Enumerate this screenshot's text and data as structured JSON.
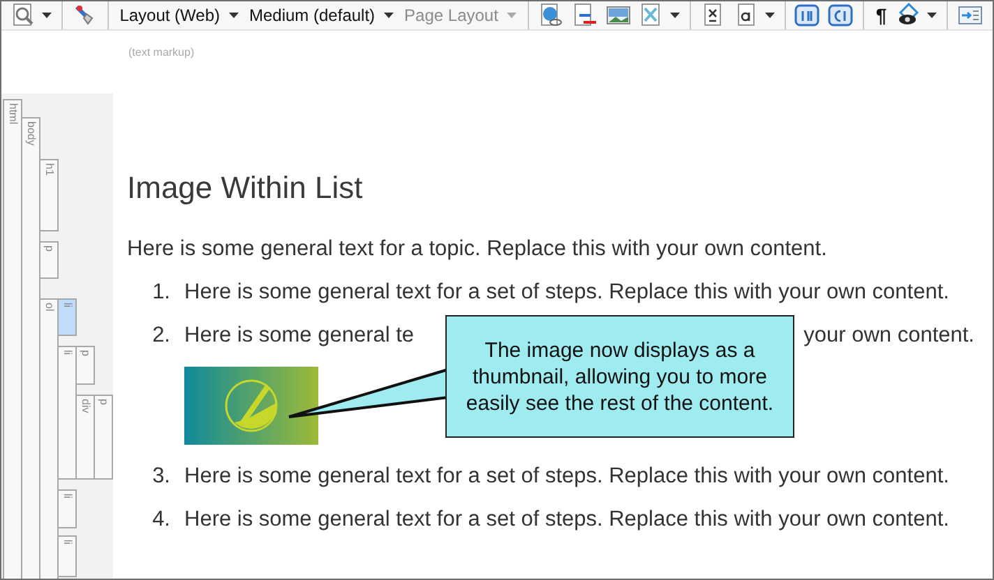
{
  "toolbar": [
    {
      "kind": "menu-button"
    },
    {
      "kind": "button"
    },
    {
      "kind": "dropdown",
      "label": "Layout (Web)",
      "disabled": false
    },
    {
      "kind": "dropdown",
      "label": "Medium (default)",
      "disabled": false
    },
    {
      "kind": "dropdown",
      "label": "Page Layout",
      "disabled": true
    },
    {
      "kind": "button"
    },
    {
      "kind": "button"
    },
    {
      "kind": "button"
    },
    {
      "kind": "menu-button"
    },
    {
      "kind": "button"
    },
    {
      "kind": "menu-button"
    },
    {
      "kind": "button"
    },
    {
      "kind": "button"
    },
    {
      "kind": "text",
      "label": "¶"
    },
    {
      "kind": "menu-button"
    },
    {
      "kind": "button"
    }
  ],
  "markup_hint": "(text markup)",
  "structure_bar": [
    {
      "label": "html",
      "selected": false,
      "children": [
        {
          "label": "body",
          "selected": false,
          "children": [
            {
              "label": "h1",
              "selected": false
            },
            {
              "label": "p",
              "selected": false
            },
            {
              "label": "ol",
              "selected": false,
              "children": [
                {
                  "label": "li",
                  "selected": true
                },
                {
                  "label": "li",
                  "selected": false,
                  "children": [
                    {
                      "label": "p",
                      "selected": false
                    },
                    {
                      "label": "div",
                      "selected": false,
                      "children": [
                        {
                          "label": "p",
                          "selected": false
                        }
                      ]
                    }
                  ]
                },
                {
                  "label": "li",
                  "selected": false
                },
                {
                  "label": "li",
                  "selected": false
                }
              ]
            }
          ]
        }
      ]
    }
  ],
  "document": {
    "heading": "Image Within List",
    "paragraph": "Here is some general text for a topic. Replace this with your own content.",
    "list": [
      {
        "kind": "text",
        "number": "1.",
        "text": "Here is some general text for a set of steps. Replace this with your own content."
      },
      {
        "kind": "covered-with-image",
        "number": "2.",
        "text": "Here is some general te",
        "text_after": "your own content."
      },
      {
        "kind": "text",
        "number": "3.",
        "text": "Here is some general text for a set of steps. Replace this with your own content."
      },
      {
        "kind": "text",
        "number": "4.",
        "text": "Here is some general text for a set of steps. Replace this with your own content."
      }
    ]
  },
  "callout": "The image now displays as a thumbnail, allowing you to more easily see the rest of the content."
}
